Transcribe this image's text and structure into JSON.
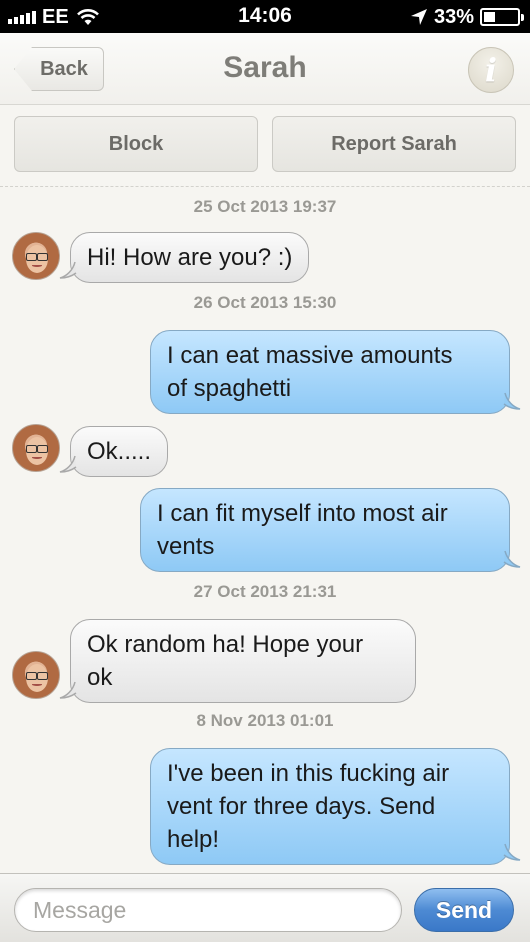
{
  "status_bar": {
    "carrier": "EE",
    "time": "14:06",
    "battery": "33%",
    "battery_level": 0.33,
    "icons": [
      "signal-icon",
      "wifi-icon",
      "location-arrow-icon",
      "battery-icon"
    ]
  },
  "nav": {
    "back_label": "Back",
    "title": "Sarah",
    "info_label": "i"
  },
  "actions": {
    "block_label": "Block",
    "report_label": "Report Sarah"
  },
  "conversation": {
    "timestamps": [
      "25 Oct 2013 19:37",
      "26 Oct 2013 15:30",
      "27 Oct 2013 21:31",
      "8 Nov 2013 01:01"
    ],
    "messages": [
      {
        "direction": "in",
        "lines": [
          "Hi! How are you? :)"
        ]
      },
      {
        "direction": "out",
        "lines": [
          "I can eat massive amounts",
          "of spaghetti"
        ]
      },
      {
        "direction": "in",
        "lines": [
          "Ok....."
        ]
      },
      {
        "direction": "out",
        "lines": [
          "I can fit myself into most air",
          "vents"
        ]
      },
      {
        "direction": "in",
        "lines": [
          "Ok random ha! Hope your",
          "ok"
        ]
      },
      {
        "direction": "out",
        "lines": [
          "I've been in this fucking air",
          "vent for three days. Send",
          "help!"
        ]
      }
    ]
  },
  "compose": {
    "placeholder": "Message",
    "value": "",
    "send_label": "Send"
  },
  "colors": {
    "incoming_bubble": "#e9e9e9",
    "outgoing_bubble": "#a9d6fa",
    "send_button": "#4a86d1",
    "background": "#f6f5f1"
  }
}
